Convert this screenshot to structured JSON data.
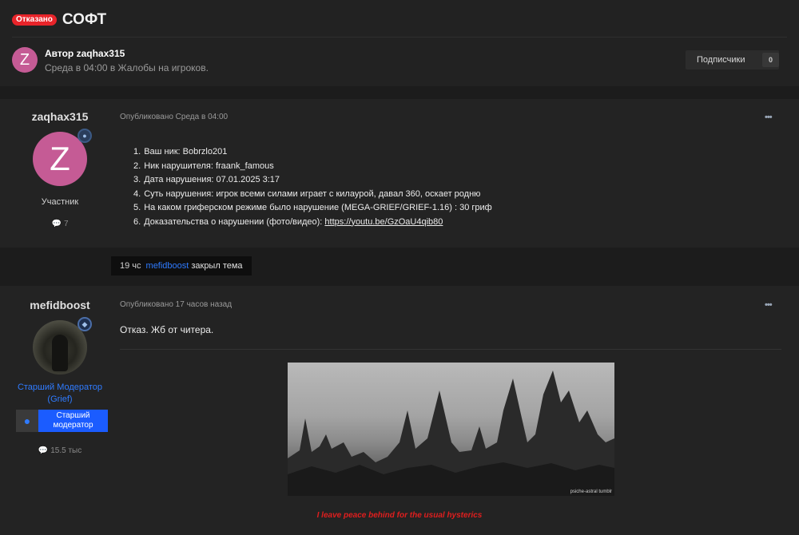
{
  "topic": {
    "status_badge": "Отказано",
    "title": "СОФТ"
  },
  "author_block": {
    "avatar_letter": "Z",
    "author_line": "Автор zaqhax315",
    "meta_line": "Среда в 04:00 в Жалобы на игроков."
  },
  "followers": {
    "label": "Подписчики",
    "count": "0"
  },
  "posts": [
    {
      "username": "zaqhax315",
      "avatar_letter": "Z",
      "role": "Участник",
      "post_count": "7",
      "meta": "Опубликовано Среда в 04:00",
      "more": "•••",
      "list": [
        {
          "n": "1.",
          "text": "Ваш ник: Bobrzlo201"
        },
        {
          "n": "2.",
          "text": "Ник нарушителя: fraank_famous"
        },
        {
          "n": "3.",
          "text": "Дата нарушения: 07.01.2025 3:17"
        },
        {
          "n": "4.",
          "text": "Суть нарушения: игрок всеми силами играет с килаурой, давал 360, оскает родню"
        },
        {
          "n": "5.",
          "text": "На каком гриферском режиме было нарушение (MEGA-GRIEF/GRIEF-1.16) : 30 гриф"
        },
        {
          "n": "6.",
          "text": "Доказательства о нарушении (фото/видео): ",
          "link": "https://youtu.be/GzOaU4qib80"
        }
      ]
    },
    {
      "username": "mefidboost",
      "role_line1": "Старший Модератор",
      "role_line2": "(Grief)",
      "group_badge_line1": "Старший",
      "group_badge_line2": "модератор",
      "post_count": "15.5 тыс",
      "meta": "Опубликовано 17 часов назад",
      "more": "•••",
      "text": "Отказ. Жб от читера.",
      "image_watermark": "psiche-astral tumblr",
      "signature": "I leave peace behind for the usual hysterics"
    }
  ],
  "event": {
    "time": "19 чс",
    "user": "mefidboost",
    "action": "закрыл тема"
  },
  "colors": {
    "badge_red": "#e8242a",
    "moderator_blue": "#2f7bff",
    "signature_red": "#e01e1e",
    "avatar_pink": "#c55b95"
  }
}
